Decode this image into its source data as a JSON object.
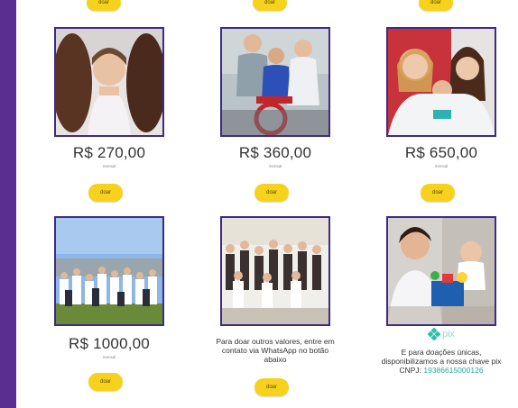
{
  "colors": {
    "brand_purple": "#5a2d91",
    "button_yellow": "#f6d21c",
    "photo_border": "#3f2a86",
    "pix_teal": "#32bcad"
  },
  "top_buttons": [
    "doar",
    "doar",
    "doar"
  ],
  "cards": [
    {
      "price": "R$ 270,00",
      "period": "mensal",
      "button": "doar",
      "photo": "two girls kissing a girl's cheeks"
    },
    {
      "price": "R$ 360,00",
      "period": "mensal",
      "button": "doar",
      "photo": "group with boy in wheelchair"
    },
    {
      "price": "R$ 650,00",
      "period": "mensal",
      "button": "doar",
      "photo": "three smiling young women"
    },
    {
      "price": "R$ 1000,00",
      "period": "mensal",
      "button": "doar",
      "photo": "large group outdoors"
    }
  ],
  "whatsapp": {
    "text": "Para doar outros valores, entre em contato via WhatsApp no botão abaixo",
    "button": "doar",
    "photo": "group photo indoors"
  },
  "pix": {
    "logo_text": "pix",
    "text": "E para doações únicas, disponibilizamos a nossa chave pix CNPJ: ",
    "key": "19386615000126",
    "photo": "young man with child and gifts"
  }
}
